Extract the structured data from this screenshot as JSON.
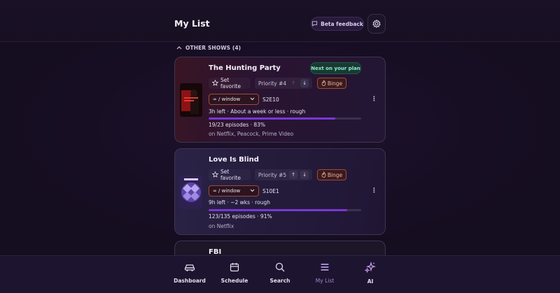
{
  "header": {
    "title": "My List",
    "beta_feedback_label": "Beta feedback",
    "settings_icon": "gear-icon"
  },
  "section": {
    "label": "OTHER SHOWS (4)",
    "icon": "chevron-up-icon"
  },
  "shows": [
    {
      "title": "The Hunting Party",
      "badge": "Next on your plan",
      "favorite_label": "Set favorite",
      "priority_label": "Priority #4",
      "binge_label": "Binge",
      "window_select": "∞ / window",
      "episode_code": "S2E10",
      "time_left": "3h left · About a week or less · rough",
      "episodes_text": "19/23 episodes · 83%",
      "progress_percent": 83,
      "services_text": "on Netflix, Peacock, Prime Video",
      "poster_colors": [
        "#1a0c0c",
        "#b0181c"
      ]
    },
    {
      "title": "Love Is Blind",
      "favorite_label": "Set favorite",
      "priority_label": "Priority #5",
      "binge_label": "Binge",
      "window_select": "∞ / window",
      "episode_code": "S10E1",
      "time_left": "9h left · ~2 wks · rough",
      "episodes_text": "123/135 episodes · 91%",
      "progress_percent": 91,
      "services_text": "on Netflix",
      "poster_colors": [
        "#3a2a6a",
        "#8a6cd8"
      ]
    },
    {
      "title": "FBI"
    }
  ],
  "bottom_nav": [
    {
      "label": "Dashboard",
      "icon": "car-icon"
    },
    {
      "label": "Schedule",
      "icon": "calendar-icon"
    },
    {
      "label": "Search",
      "icon": "search-icon"
    },
    {
      "label": "My List",
      "icon": "list-icon",
      "active": true
    },
    {
      "label": "AI",
      "icon": "sparkle-icon"
    }
  ],
  "colors": {
    "accent_purple": "#7b36d6",
    "next_badge_green": "#8fe7c6",
    "binge_orange": "#f0b199"
  }
}
